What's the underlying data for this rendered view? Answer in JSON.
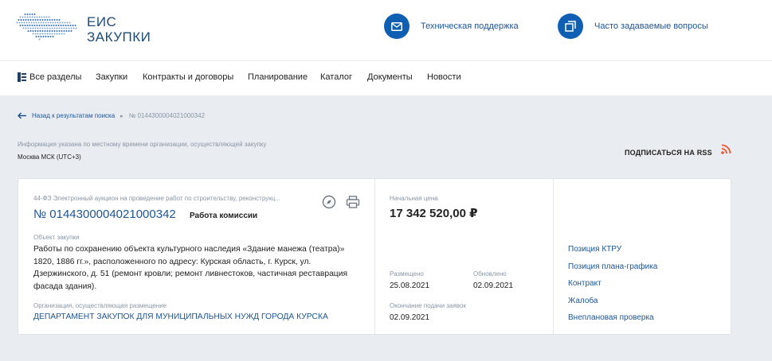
{
  "header": {
    "logo_line1": "ЕИС",
    "logo_line2": "ЗАКУПКИ",
    "support_label": "Техническая поддержка",
    "faq_label": "Часто задаваемые вопросы",
    "accent_color": "#0f5fb3"
  },
  "nav": {
    "items": [
      "Все разделы",
      "Закупки",
      "Контракты и договоры",
      "Планирование",
      "Каталог",
      "Документы",
      "Новости"
    ]
  },
  "breadcrumb": {
    "back_label": "Назад к результатам поиска",
    "current": "№ 0144300004021000342"
  },
  "info": {
    "note": "Информация указана по местному времени организации, осуществляющей закупку",
    "timezone": "Москва МСК (UTC+3)"
  },
  "rss": {
    "label": "ПОДПИСАТЬСЯ НА RSS",
    "icon": "rss-icon"
  },
  "card": {
    "procedure_type": "44-ФЗ Электронный аукцион на проведение работ по строительству, реконструкц...",
    "number": "№ 0144300004021000342",
    "stage": "Работа комиссии",
    "object_label": "Объект закупки",
    "object_text": "Работы по сохранению объекта культурного наследия «Здание манежа (театра)» 1820, 1886 гг.», расположенного по адресу: Курская область, г. Курск, ул. Дзержинского, д. 51 (ремонт кровли; ремонт ливнестоков, частичная реставрация фасада здания).",
    "org_label": "Организация, осуществляющая размещение",
    "org_name": "ДЕПАРТАМЕНТ ЗАКУПОК ДЛЯ МУНИЦИПАЛЬНЫХ НУЖД ГОРОДА КУРСКА",
    "price_label": "Начальная цена",
    "price": "17 342 520,00 ₽",
    "placed_label": "Размещено",
    "placed_date": "25.08.2021",
    "updated_label": "Обновлено",
    "updated_date": "02.09.2021",
    "end_label": "Окончание подачи заявок",
    "end_date": "02.09.2021",
    "links": [
      "Позиция КТРУ",
      "Позиция плана-графика",
      "Контракт",
      "Жалоба",
      "Внеплановая проверка"
    ]
  }
}
